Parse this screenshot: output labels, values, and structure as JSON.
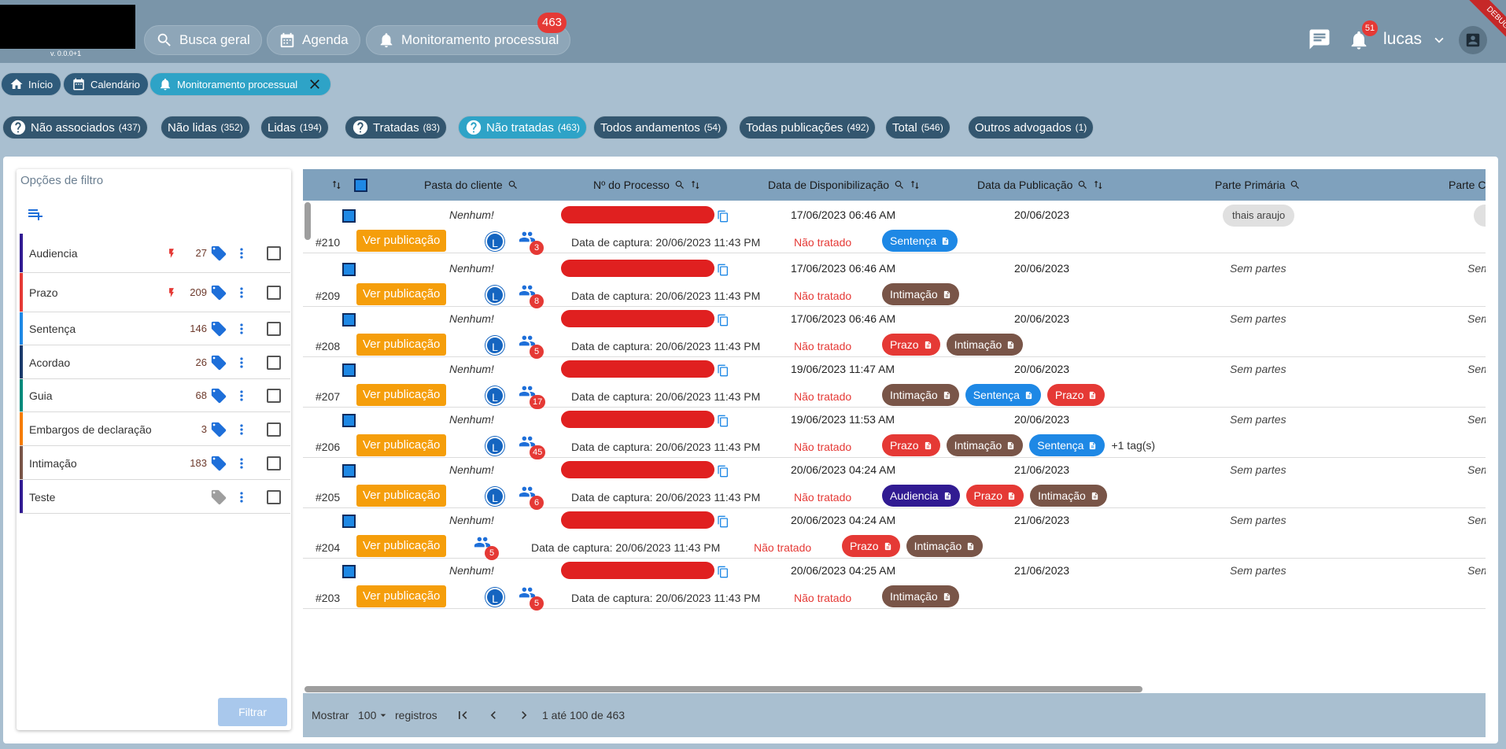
{
  "app": {
    "version": "v. 0.0.0+1",
    "debug_label": "DEBUG"
  },
  "nav": {
    "search_label": "Busca geral",
    "agenda_label": "Agenda",
    "monitor_label": "Monitoramento processual",
    "monitor_badge": "463"
  },
  "header": {
    "notif_badge": "51",
    "user_name": "lucas"
  },
  "breadcrumbs": {
    "home": "Início",
    "calendar": "Calendário",
    "monitor": "Monitoramento processual"
  },
  "chips": [
    {
      "label": "Não associados",
      "count": "(437)",
      "icon": "help-circle-icon"
    },
    {
      "label": "Não lidas",
      "count": "(352)"
    },
    {
      "label": "Lidas",
      "count": "(194)"
    },
    {
      "label": "Tratadas",
      "count": "(83)",
      "icon": "help-circle-icon"
    },
    {
      "label": "Não tratadas",
      "count": "(463)",
      "icon": "help-circle-icon",
      "active": true
    },
    {
      "label": "Todos andamentos",
      "count": "(54)"
    },
    {
      "label": "Todas publicações",
      "count": "(492)"
    },
    {
      "label": "Total",
      "count": "(546)"
    },
    {
      "label": "Outros advogados",
      "count": "(1)"
    }
  ],
  "filter": {
    "title": "Opções de filtro",
    "button_label": "Filtrar",
    "items": [
      {
        "label": "Audiencia",
        "count": "27",
        "color": "#311b92",
        "bolt": true
      },
      {
        "label": "Prazo",
        "count": "209",
        "color": "#e53935",
        "bolt": true
      },
      {
        "label": "Sentença",
        "count": "146",
        "color": "#1e88e5"
      },
      {
        "label": "Acordao",
        "count": "26",
        "color": "#1a3a6b"
      },
      {
        "label": "Guia",
        "count": "68",
        "color": "#00897b"
      },
      {
        "label": "Embargos de declaração",
        "count": "3",
        "color": "#f57c00"
      },
      {
        "label": "Intimação",
        "count": "183",
        "color": "#795548"
      },
      {
        "label": "Teste",
        "count": "",
        "color": "#311b92",
        "gray_tag": true
      }
    ]
  },
  "table": {
    "columns": {
      "pasta": "Pasta do cliente",
      "processo": "Nº do Processo",
      "disponibilizacao": "Data de Disponibilização",
      "publicacao": "Data da Publicação",
      "parte_primaria": "Parte Primária",
      "parte_c": "Parte C"
    },
    "view_label": "Ver publicação",
    "none_label": "Nenhum!",
    "status_label": "Não tratado",
    "avatar_letter": "L",
    "rows": [
      {
        "id": "#210",
        "disp": "17/06/2023 06:46 AM",
        "pub": "20/06/2023",
        "capture": "Data de captura: 20/06/2023 11:43 PM",
        "people": "3",
        "parte": "thais araujo",
        "parte_chip": true,
        "avatar": true,
        "tags": [
          {
            "label": "Sentença",
            "color": "#1e88e5"
          }
        ]
      },
      {
        "id": "#209",
        "disp": "17/06/2023 06:46 AM",
        "pub": "20/06/2023",
        "capture": "Data de captura: 20/06/2023 11:43 PM",
        "people": "8",
        "parte": "Sem partes",
        "parte2": "Sem",
        "avatar": true,
        "tags": [
          {
            "label": "Intimação",
            "color": "#795548"
          }
        ]
      },
      {
        "id": "#208",
        "disp": "17/06/2023 06:46 AM",
        "pub": "20/06/2023",
        "capture": "Data de captura: 20/06/2023 11:43 PM",
        "people": "5",
        "parte": "Sem partes",
        "parte2": "Sem",
        "avatar": true,
        "tags": [
          {
            "label": "Prazo",
            "color": "#e53935"
          },
          {
            "label": "Intimação",
            "color": "#795548"
          }
        ]
      },
      {
        "id": "#207",
        "disp": "19/06/2023 11:47 AM",
        "pub": "20/06/2023",
        "capture": "Data de captura: 20/06/2023 11:43 PM",
        "people": "17",
        "parte": "Sem partes",
        "parte2": "Sem",
        "avatar": true,
        "tags": [
          {
            "label": "Intimação",
            "color": "#795548"
          },
          {
            "label": "Sentença",
            "color": "#1e88e5"
          },
          {
            "label": "Prazo",
            "color": "#e53935"
          }
        ]
      },
      {
        "id": "#206",
        "disp": "19/06/2023 11:53 AM",
        "pub": "20/06/2023",
        "capture": "Data de captura: 20/06/2023 11:43 PM",
        "people": "45",
        "parte": "Sem partes",
        "parte2": "Sem",
        "avatar": true,
        "tags": [
          {
            "label": "Prazo",
            "color": "#e53935"
          },
          {
            "label": "Intimação",
            "color": "#795548"
          },
          {
            "label": "Sentença",
            "color": "#1e88e5"
          }
        ],
        "more": "+1 tag(s)"
      },
      {
        "id": "#205",
        "disp": "20/06/2023 04:24 AM",
        "pub": "21/06/2023",
        "capture": "Data de captura: 20/06/2023 11:43 PM",
        "people": "6",
        "parte": "Sem partes",
        "parte2": "Sem",
        "avatar": true,
        "tags": [
          {
            "label": "Audiencia",
            "color": "#311b92"
          },
          {
            "label": "Prazo",
            "color": "#e53935"
          },
          {
            "label": "Intimação",
            "color": "#795548"
          }
        ]
      },
      {
        "id": "#204",
        "disp": "20/06/2023 04:24 AM",
        "pub": "21/06/2023",
        "capture": "Data de captura: 20/06/2023 11:43 PM",
        "people": "5",
        "parte": "Sem partes",
        "parte2": "Sem",
        "avatar": false,
        "tags": [
          {
            "label": "Prazo",
            "color": "#e53935"
          },
          {
            "label": "Intimação",
            "color": "#795548"
          }
        ]
      },
      {
        "id": "#203",
        "disp": "20/06/2023 04:25 AM",
        "pub": "21/06/2023",
        "capture": "Data de captura: 20/06/2023 11:43 PM",
        "people": "5",
        "parte": "Sem partes",
        "parte2": "Sem",
        "avatar": true,
        "tags": [
          {
            "label": "Intimação",
            "color": "#795548"
          }
        ]
      }
    ]
  },
  "footer": {
    "show_label": "Mostrar",
    "page_size": "100",
    "records_label": "registros",
    "range_label": "1 até 100 de 463"
  }
}
